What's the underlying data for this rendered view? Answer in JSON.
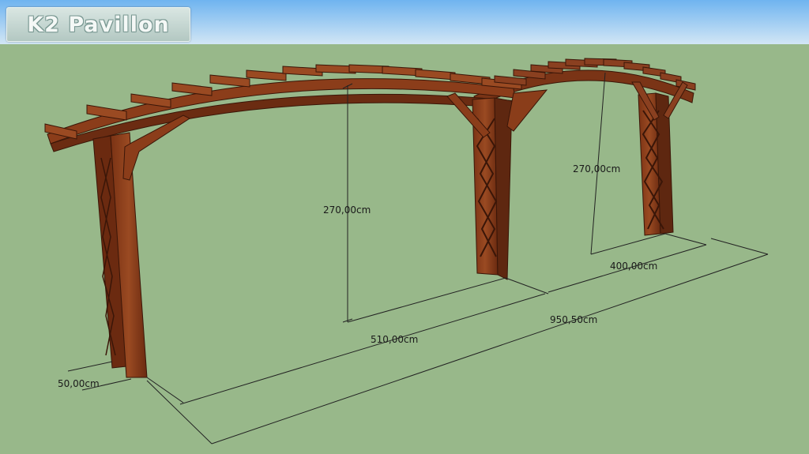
{
  "header": {
    "logo_text": "K2 Pavillon"
  },
  "dimensions": {
    "height_front": "270,00cm",
    "height_back": "270,00cm",
    "span_front": "510,00cm",
    "span_back": "400,00cm",
    "total_length": "950,50cm",
    "post_depth": "50,00cm"
  },
  "colors": {
    "sky": "#79b8ee",
    "ground": "#98b88a",
    "wood": "#8a3d1c",
    "wood_dark": "#5e2710"
  }
}
